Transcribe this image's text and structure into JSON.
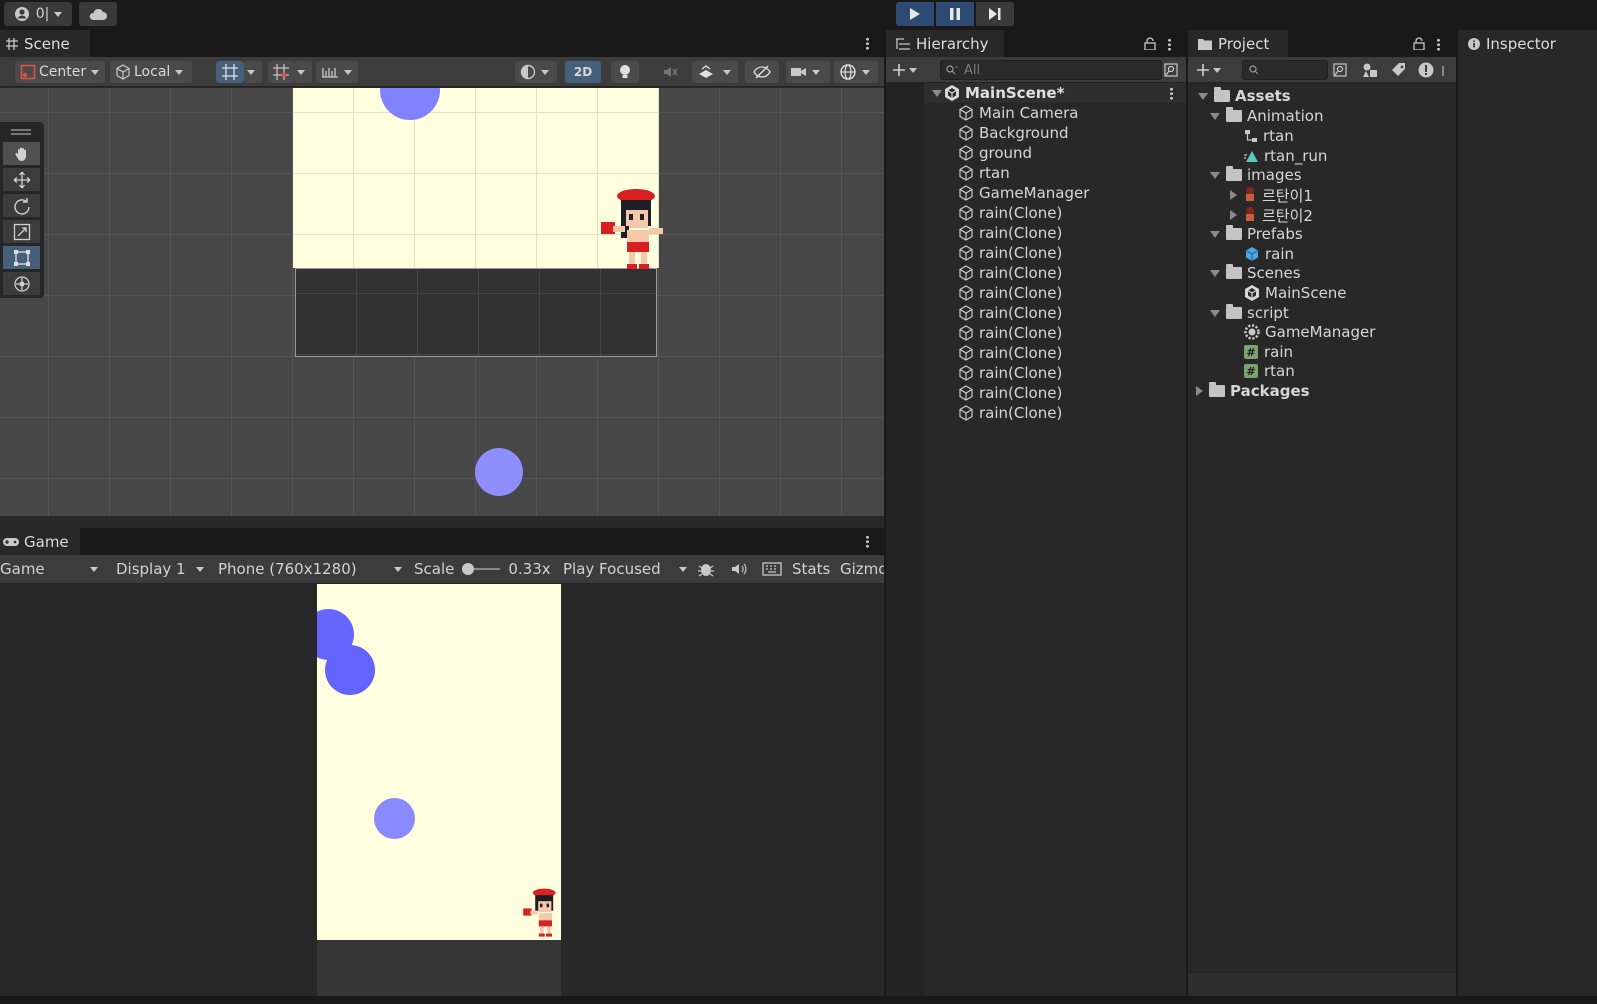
{
  "toolbar": {
    "account_label": "0|",
    "play_icon": "play-icon",
    "pause_icon": "pause-icon",
    "step_icon": "step-icon"
  },
  "scene": {
    "tab_label": "Scene",
    "pivot_label": "Center",
    "space_label": "Local",
    "mode_2d_label": "2D"
  },
  "game": {
    "tab_label": "Game",
    "view_select": "Game",
    "display_select": "Display 1",
    "resolution_select": "Phone (760x1280)",
    "scale_label": "Scale",
    "scale_value": "0.33x",
    "play_mode_select": "Play Focused",
    "stats_label": "Stats",
    "gizmos_label": "Gizmo"
  },
  "hierarchy": {
    "tab_label": "Hierarchy",
    "search_placeholder": "All",
    "scene_name": "MainScene*",
    "items": [
      "Main Camera",
      "Background",
      "ground",
      "rtan",
      "GameManager",
      "rain(Clone)",
      "rain(Clone)",
      "rain(Clone)",
      "rain(Clone)",
      "rain(Clone)",
      "rain(Clone)",
      "rain(Clone)",
      "rain(Clone)",
      "rain(Clone)",
      "rain(Clone)",
      "rain(Clone)"
    ]
  },
  "project": {
    "tab_label": "Project",
    "assets_label": "Assets",
    "animation_folder": "Animation",
    "anim_rtan": "rtan",
    "anim_rtan_run": "rtan_run",
    "images_folder": "images",
    "image_1": "르탄이1",
    "image_2": "르탄이2",
    "prefabs_folder": "Prefabs",
    "prefab_rain": "rain",
    "scenes_folder": "Scenes",
    "scene_main": "MainScene",
    "script_folder": "script",
    "script_gm": "GameManager",
    "script_rain": "rain",
    "script_rtan": "rtan",
    "packages_label": "Packages"
  },
  "inspector": {
    "tab_label": "Inspector"
  },
  "colors": {
    "sky": "#ffffe0",
    "rain": "#6b6bff",
    "rain_light": "#8f8fff",
    "accent_blue": "#46607c"
  }
}
